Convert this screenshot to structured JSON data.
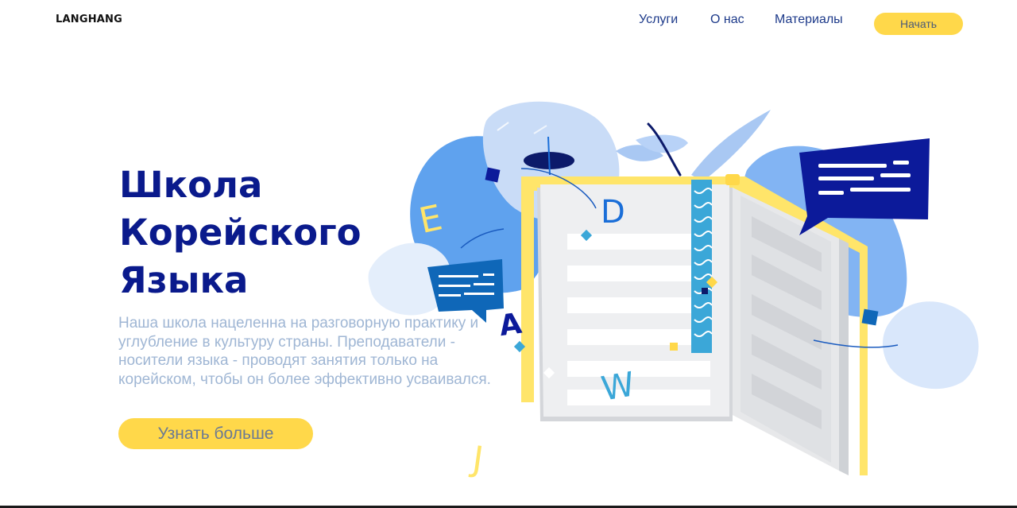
{
  "header": {
    "logo": "LANGHANG",
    "nav": [
      {
        "label": "Услуги"
      },
      {
        "label": "О нас"
      },
      {
        "label": "Материалы"
      }
    ],
    "start_button": "Начать"
  },
  "hero": {
    "title_lines": [
      "Школа",
      "Корейского",
      "Языка"
    ],
    "description": "Наша школа нацеленна на разговорную практику и углубление в культуру страны. Преподаватели - носители языка - проводят занятия только на корейском, чтобы он более эффективно усваивался.",
    "cta_button": "Узнать больше"
  },
  "illustration": {
    "letters": [
      "E",
      "D",
      "A",
      "W",
      "J"
    ]
  },
  "colors": {
    "accent": "#ffd84a",
    "title": "#0a1a8c",
    "nav": "#1d3a8a",
    "text": "#9fb6d4"
  }
}
